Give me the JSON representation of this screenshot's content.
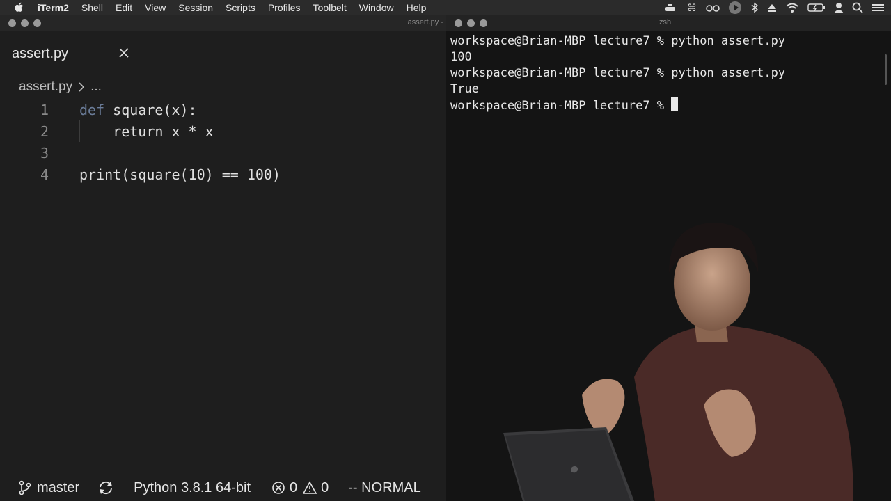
{
  "menubar": {
    "app_name": "iTerm2",
    "items": [
      "Shell",
      "Edit",
      "View",
      "Session",
      "Scripts",
      "Profiles",
      "Toolbelt",
      "Window",
      "Help"
    ]
  },
  "editor": {
    "window_title": "assert.py -",
    "tab_title": "assert.py",
    "breadcrumb": {
      "file": "assert.py",
      "more": "..."
    },
    "lines": [
      {
        "num": "1",
        "keyword": "def",
        "text": " square(x):"
      },
      {
        "num": "2",
        "keyword": "",
        "text": "    return x * x"
      },
      {
        "num": "3",
        "keyword": "",
        "text": ""
      },
      {
        "num": "4",
        "keyword": "",
        "text": "print(square(10) == 100)"
      }
    ],
    "status": {
      "branch": "master",
      "interpreter": "Python 3.8.1 64-bit",
      "errors": "0",
      "warnings": "0",
      "mode": "-- NORMAL"
    }
  },
  "terminal": {
    "window_title": "zsh",
    "lines": [
      "workspace@Brian-MBP lecture7 % python assert.py",
      "100",
      "workspace@Brian-MBP lecture7 % python assert.py",
      "True",
      "workspace@Brian-MBP lecture7 % "
    ]
  }
}
